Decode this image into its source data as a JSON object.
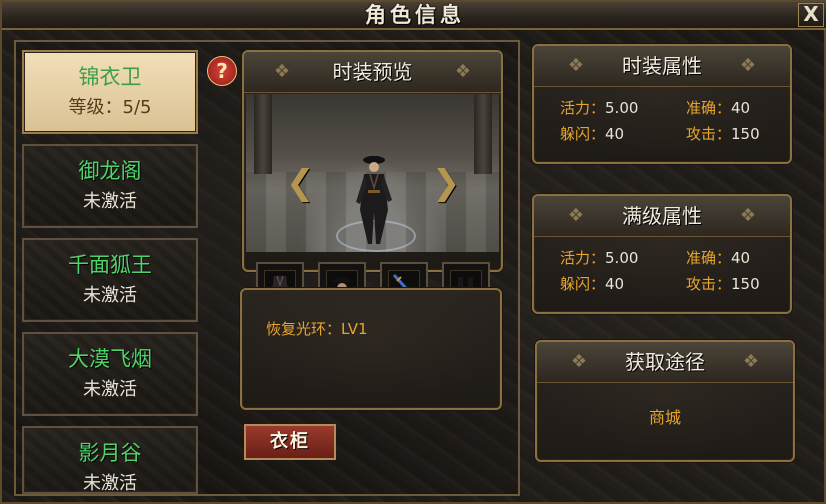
{
  "window": {
    "title": "角色信息",
    "close_label": "X"
  },
  "help_label": "?",
  "characters": [
    {
      "name": "锦衣卫",
      "status": "等级：5/5",
      "selected": true
    },
    {
      "name": "御龙阁",
      "status": "未激活",
      "selected": false
    },
    {
      "name": "千面狐王",
      "status": "未激活",
      "selected": false
    },
    {
      "name": "大漠飞烟",
      "status": "未激活",
      "selected": false
    },
    {
      "name": "影月谷",
      "status": "未激活",
      "selected": false
    }
  ],
  "preview": {
    "title": "时装预览",
    "prev_arrow": "❮",
    "next_arrow": "❯",
    "slots": [
      {
        "icon": "armor-icon"
      },
      {
        "icon": "hat-icon"
      },
      {
        "icon": "sword-icon"
      },
      {
        "icon": "boots-icon"
      }
    ]
  },
  "description": {
    "text": "恢复光环：LV1"
  },
  "wardrobe_button": "衣柜",
  "fashion_attributes": {
    "title": "时装属性",
    "stats": {
      "vitality_label": "活力：",
      "vitality_value": "5.00",
      "accuracy_label": "准确：",
      "accuracy_value": "40",
      "dodge_label": "躲闪：",
      "dodge_value": "40",
      "attack_label": "攻击：",
      "attack_value": "150"
    }
  },
  "max_level_attributes": {
    "title": "满级属性",
    "stats": {
      "vitality_label": "活力：",
      "vitality_value": "5.00",
      "accuracy_label": "准确：",
      "accuracy_value": "40",
      "dodge_label": "躲闪：",
      "dodge_value": "40",
      "attack_label": "攻击：",
      "attack_value": "150"
    }
  },
  "acquisition": {
    "title": "获取途径",
    "source": "商城"
  },
  "colors": {
    "label_orange": "#e7a52c",
    "name_green": "#4fd46a",
    "frame_gold": "#8a6f3f"
  }
}
